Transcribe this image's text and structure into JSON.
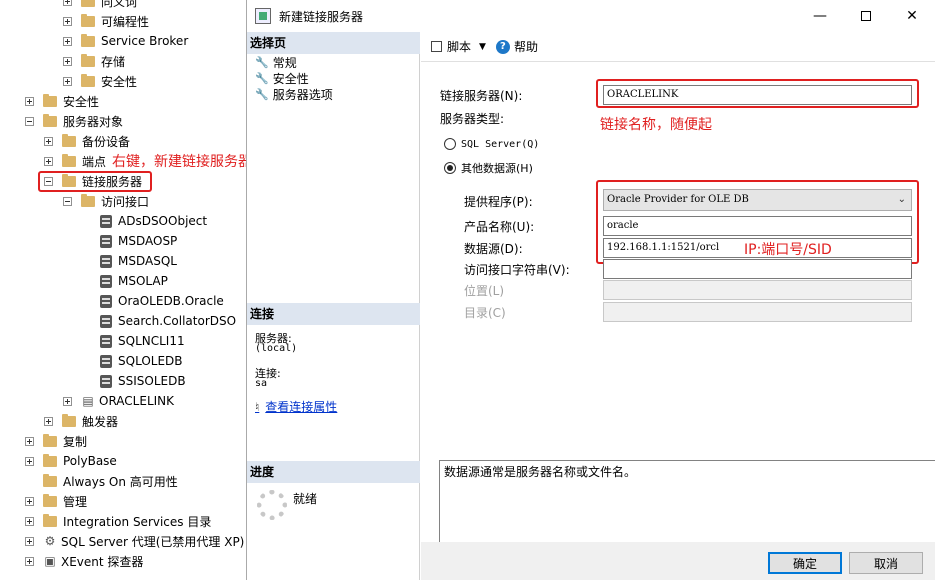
{
  "tree": {
    "items": [
      {
        "label": "同义词",
        "icon": "folder-icon"
      },
      {
        "label": "可编程性",
        "icon": "folder-icon"
      },
      {
        "label": "Service Broker",
        "icon": "folder-icon"
      },
      {
        "label": "存储",
        "icon": "folder-icon"
      },
      {
        "label": "安全性",
        "icon": "folder-icon"
      },
      {
        "label": "安全性",
        "icon": "folder-icon"
      },
      {
        "label": "服务器对象",
        "icon": "folder-icon"
      },
      {
        "label": "备份设备",
        "icon": "folder-icon"
      },
      {
        "label": "端点",
        "icon": "folder-icon"
      },
      {
        "label": "链接服务器",
        "icon": "folder-icon"
      },
      {
        "label": "访问接口",
        "icon": "folder-icon"
      },
      {
        "label": "ADsDSOObject",
        "icon": "provider-icon"
      },
      {
        "label": "MSDAOSP",
        "icon": "provider-icon"
      },
      {
        "label": "MSDASQL",
        "icon": "provider-icon"
      },
      {
        "label": "MSOLAP",
        "icon": "provider-icon"
      },
      {
        "label": "OraOLEDB.Oracle",
        "icon": "provider-icon"
      },
      {
        "label": "Search.CollatorDSO",
        "icon": "provider-icon"
      },
      {
        "label": "SQLNCLI11",
        "icon": "provider-icon"
      },
      {
        "label": "SQLOLEDB",
        "icon": "provider-icon"
      },
      {
        "label": "SSISOLEDB",
        "icon": "provider-icon"
      },
      {
        "label": "ORACLELINK",
        "icon": "linked-server-icon"
      },
      {
        "label": "触发器",
        "icon": "folder-icon"
      },
      {
        "label": "复制",
        "icon": "folder-icon"
      },
      {
        "label": "PolyBase",
        "icon": "folder-icon"
      },
      {
        "label": "Always On 高可用性",
        "icon": "folder-icon"
      },
      {
        "label": "管理",
        "icon": "folder-icon"
      },
      {
        "label": "Integration Services 目录",
        "icon": "folder-icon"
      },
      {
        "label": "SQL Server 代理(已禁用代理 XP)",
        "icon": "agent-icon"
      },
      {
        "label": "XEvent 探查器",
        "icon": "xevent-icon"
      }
    ],
    "note": "右键，新建链接服务器"
  },
  "dialog": {
    "title": "新建链接服务器",
    "left": {
      "select_page_header": "选择页",
      "pages": [
        "常规",
        "安全性",
        "服务器选项"
      ],
      "connection_header": "连接",
      "server_label": "服务器:",
      "server_value": "(local)",
      "connection_label": "连接:",
      "connection_value": "sa",
      "view_props_link": "查看连接属性",
      "progress_header": "进度",
      "progress_status": "就绪"
    },
    "toolbar": {
      "script_label": "脚本",
      "help_label": "帮助"
    },
    "form": {
      "linked_server_label": "链接服务器(N):",
      "linked_server_value": "ORACLELINK",
      "linked_server_note": "链接名称，随便起",
      "server_type_label": "服务器类型:",
      "radio_sql_server": "SQL Server(Q)",
      "radio_other": "其他数据源(H)",
      "provider_label": "提供程序(P):",
      "provider_value": "Oracle Provider for OLE DB",
      "product_name_label": "产品名称(U):",
      "product_name_value": "oracle",
      "data_source_label": "数据源(D):",
      "data_source_value": "192.168.1.1:1521/orcl",
      "data_source_note": "IP:端口号/SID",
      "provider_string_label": "访问接口字符串(V):",
      "location_label": "位置(L)",
      "catalog_label": "目录(C)",
      "description": "数据源通常是服务器名称或文件名。"
    },
    "buttons": {
      "ok": "确定",
      "cancel": "取消"
    }
  },
  "colors": {
    "annotation_red": "#e02020",
    "section_header_bg": "#dde5f0",
    "link_blue": "#0033cc"
  }
}
